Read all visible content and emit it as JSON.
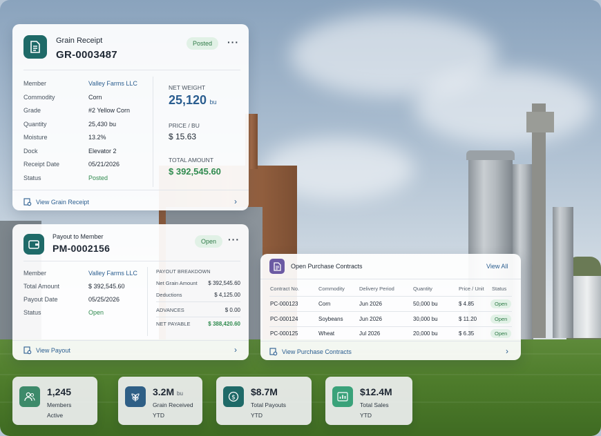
{
  "grain_receipt": {
    "title": "Grain Receipt",
    "number": "GR-0003487",
    "status_badge": "Posted",
    "fields": [
      {
        "label": "Member",
        "value": "Valley Farms LLC"
      },
      {
        "label": "Commodity",
        "value": "Corn"
      },
      {
        "label": "Grade",
        "value": "#2 Yellow Corn"
      },
      {
        "label": "Quantity",
        "value": "25,430 bu"
      },
      {
        "label": "Moisture",
        "value": "13.2%"
      },
      {
        "label": "Dock",
        "value": "Elevator 2"
      },
      {
        "label": "Receipt Date",
        "value": "05/21/2026"
      },
      {
        "label": "Status",
        "value": "Posted"
      }
    ],
    "net_weight_label": "NET WEIGHT",
    "net_weight_value": "25,120",
    "net_weight_unit": "bu",
    "price_label": "PRICE / BU",
    "price_value": "$ 15.63",
    "total_label": "TOTAL AMOUNT",
    "total_value": "$ 392,545.60",
    "footer_link": "View Grain Receipt"
  },
  "payout": {
    "title": "Payout to Member",
    "number": "PM-0002156",
    "status_badge": "Open",
    "fields": [
      {
        "label": "Member",
        "value": "Valley Farms LLC"
      },
      {
        "label": "Total Amount",
        "value": "$ 392,545.60"
      },
      {
        "label": "Payout Date",
        "value": "05/25/2026"
      },
      {
        "label": "Status",
        "value": "Open"
      }
    ],
    "breakdown_title": "PAYOUT BREAKDOWN",
    "breakdown": [
      {
        "label": "Net Grain Amount",
        "value": "$ 392,545.60"
      },
      {
        "label": "Deductions",
        "value": "$ 4,125.00"
      },
      {
        "label": "ADVANCES",
        "value": "$ 0.00"
      },
      {
        "label": "NET PAYABLE",
        "value": "$ 388,420.60"
      }
    ],
    "footer_link": "View Payout"
  },
  "contracts": {
    "title": "Open Purchase Contracts",
    "view_all": "View All",
    "columns": [
      "Contract No.",
      "Commodity",
      "Delivery Period",
      "Quantity",
      "Price / Unit",
      "Status"
    ],
    "rows": [
      {
        "no": "PC-000123",
        "commodity": "Corn",
        "period": "Jun 2026",
        "quantity": "50,000 bu",
        "price": "$ 4.85",
        "status": "Open"
      },
      {
        "no": "PC-000124",
        "commodity": "Soybeans",
        "period": "Jun 2026",
        "quantity": "30,000 bu",
        "price": "$ 11.20",
        "status": "Open"
      },
      {
        "no": "PC-000125",
        "commodity": "Wheat",
        "period": "Jul 2026",
        "quantity": "20,000 bu",
        "price": "$ 6.35",
        "status": "Open"
      }
    ],
    "footer_link": "View Purchase Contracts"
  },
  "stats": [
    {
      "value": "1,245",
      "unit": "",
      "line1": "Members",
      "line2": "Active",
      "icon": "members-icon",
      "color": "#3d8a6a"
    },
    {
      "value": "3.2M",
      "unit": "bu",
      "line1": "Grain Received",
      "line2": "YTD",
      "icon": "grain-icon",
      "color": "#2f5f86"
    },
    {
      "value": "$8.7M",
      "unit": "",
      "line1": "Total Payouts",
      "line2": "YTD",
      "icon": "dollar-icon",
      "color": "#1f6a68"
    },
    {
      "value": "$12.4M",
      "unit": "",
      "line1": "Total Sales",
      "line2": "YTD",
      "icon": "chart-icon",
      "color": "#3aa27a"
    }
  ],
  "colors": {
    "teal": "#1f6a68",
    "link": "#2a5d8f",
    "green": "#2f8a4e",
    "purple": "#6b5aa3"
  }
}
